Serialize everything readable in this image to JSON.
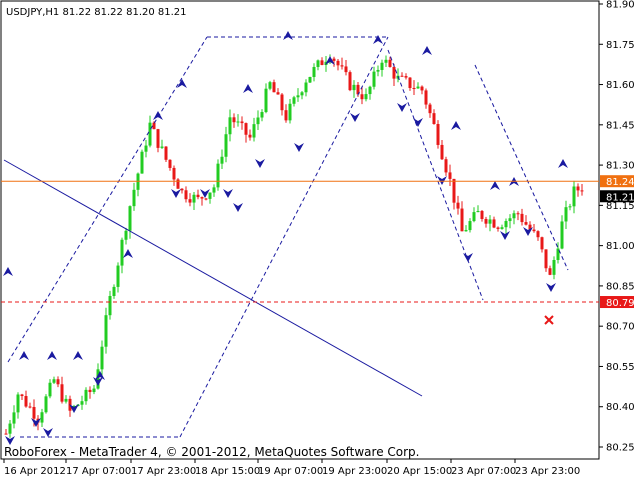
{
  "chart_data": {
    "type": "candlestick",
    "symbol_header": "USDJPY,H1  81.22 81.22 81.20 81.21",
    "footer": "RoboForex - MetaTrader 4, © 2001-2012, MetaQuotes Software Corp.",
    "y_ticks": [
      "81.90",
      "81.75",
      "81.60",
      "81.45",
      "81.30",
      "81.15",
      "81.00",
      "80.85",
      "80.70",
      "80.55",
      "80.40",
      "80.25"
    ],
    "x_ticks": [
      "16 Apr 2012",
      "17 Apr 07:00",
      "17 Apr 23:00",
      "18 Apr 15:00",
      "19 Apr 07:00",
      "19 Apr 23:00",
      "20 Apr 15:00",
      "23 Apr 07:00",
      "23 Apr 23:00"
    ],
    "ylim": [
      80.22,
      81.92
    ],
    "grid": false,
    "horizontal_levels": [
      {
        "value": 81.24,
        "label": "81.24",
        "color": "#f07010",
        "style": "solid"
      },
      {
        "value": 80.79,
        "label": "80.79",
        "color": "#e81818",
        "style": "dashed"
      }
    ],
    "current_price": {
      "value": 81.21,
      "label": "81.21"
    },
    "colors": {
      "bull": "#22cc22",
      "bear": "#e81818",
      "channel": "#1a1aa0",
      "arrow": "#1a1aa0"
    }
  }
}
